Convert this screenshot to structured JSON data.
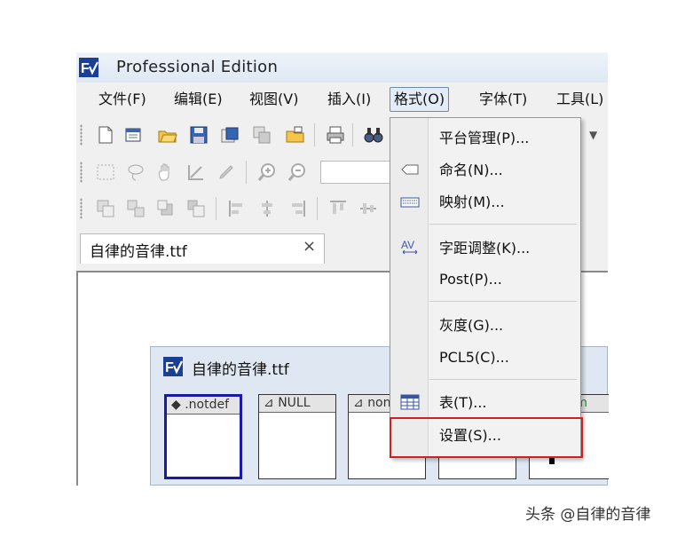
{
  "window": {
    "title": "Professional Edition"
  },
  "menubar": {
    "items": [
      {
        "label": "文件(F)"
      },
      {
        "label": "编辑(E)"
      },
      {
        "label": "视图(V)"
      },
      {
        "label": "插入(I)"
      },
      {
        "label": "格式(O)"
      },
      {
        "label": "字体(T)"
      },
      {
        "label": "工具(L)"
      }
    ],
    "active": "格式(O)"
  },
  "document_tab": {
    "label": "自律的音律.ttf",
    "close_glyph": "×"
  },
  "font_window": {
    "title": "自律的音律.ttf",
    "glyphs": [
      {
        "label": ".notdef",
        "marker": "◆"
      },
      {
        "label": "NULL",
        "marker": "⊿"
      },
      {
        "label": "non",
        "marker": "⊿"
      },
      {
        "label": "",
        "marker": ""
      },
      {
        "label": "m",
        "marker": ""
      }
    ]
  },
  "format_menu": {
    "items": [
      {
        "label": "平台管理(P)...",
        "icon": ""
      },
      {
        "label": "命名(N)...",
        "icon": "tag-icon"
      },
      {
        "label": "映射(M)...",
        "icon": "keyboard-icon"
      },
      {
        "label": "字距调整(K)...",
        "icon": "kerning-icon"
      },
      {
        "label": "Post(P)...",
        "icon": ""
      },
      {
        "label": "灰度(G)...",
        "icon": ""
      },
      {
        "label": "PCL5(C)...",
        "icon": ""
      },
      {
        "label": "表(T)...",
        "icon": "table-icon"
      },
      {
        "label": "设置(S)...",
        "icon": ""
      }
    ],
    "highlighted": "设置(S)...",
    "highlight_color": "#d02020"
  },
  "toolbar": {
    "dropdown_arrow": "▼"
  },
  "watermark": {
    "text": "头条 @自律的音律"
  }
}
